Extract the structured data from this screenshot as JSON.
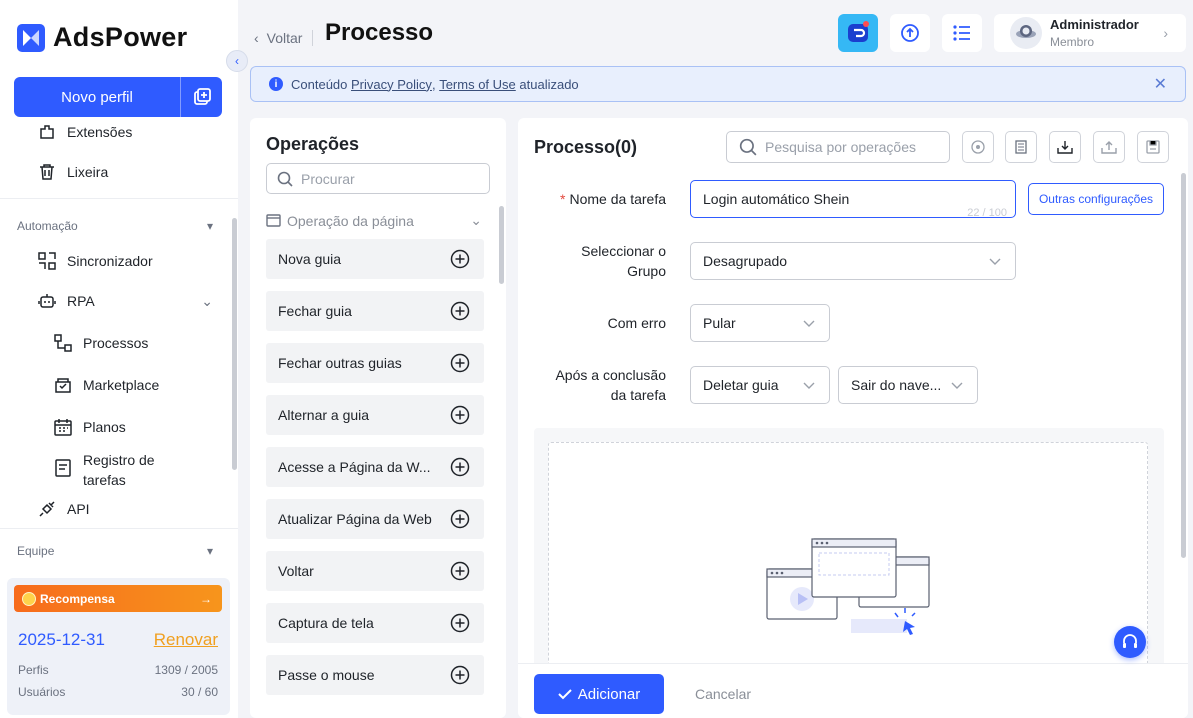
{
  "app": {
    "name": "AdsPower"
  },
  "sidebar": {
    "new_profile_label": "Novo perfil",
    "items": [
      {
        "label": "Extensões"
      },
      {
        "label": "Lixeira"
      }
    ],
    "section_automation": "Automação",
    "automation_items": [
      {
        "label": "Sincronizador"
      },
      {
        "label": "RPA"
      }
    ],
    "rpa_sub": [
      {
        "label": "Processos"
      },
      {
        "label": "Marketplace"
      },
      {
        "label": "Planos"
      },
      {
        "label": "Registro de tarefas"
      }
    ],
    "api_label": "API",
    "section_team": "Equipe",
    "reward": {
      "title": "Recompensa",
      "date": "2025-12-31",
      "renew": "Renovar",
      "profiles_label": "Perfis",
      "profiles_value": "1309 / 2005",
      "users_label": "Usuários",
      "users_value": "30 / 60"
    }
  },
  "header": {
    "back_label": "Voltar",
    "title": "Processo",
    "user_name": "Administrador",
    "user_role": "Membro"
  },
  "notice": {
    "prefix": "Conteúdo",
    "link1": "Privacy Policy",
    "comma": ",",
    "link2": "Terms of Use",
    "suffix": "atualizado"
  },
  "operations": {
    "title": "Operações",
    "search_placeholder": "Procurar",
    "category": "Operação da página",
    "items": [
      "Nova guia",
      "Fechar guia",
      "Fechar outras guias",
      "Alternar a guia",
      "Acesse a Página da W...",
      "Atualizar Página da Web",
      "Voltar",
      "Captura de tela",
      "Passe o mouse"
    ]
  },
  "process": {
    "title": "Processo(0)",
    "search_placeholder": "Pesquisa por operações",
    "task_name_label": "Nome da tarefa",
    "task_name_value": "Login automático Shein",
    "task_name_counter": "22 / 100",
    "other_config": "Outras configurações",
    "group_label": "Seleccionar o Grupo",
    "group_value": "Desagrupado",
    "error_label": "Com erro",
    "error_value": "Pular",
    "after_label": "Após a conclusão da tarefa",
    "after_value1": "Deletar guia",
    "after_value2": "Sair do nave...",
    "add_button": "Adicionar",
    "cancel_button": "Cancelar"
  },
  "colors": {
    "primary": "#2f5bff",
    "reward_orange": "#f76b1c",
    "renew": "#f0a020"
  }
}
